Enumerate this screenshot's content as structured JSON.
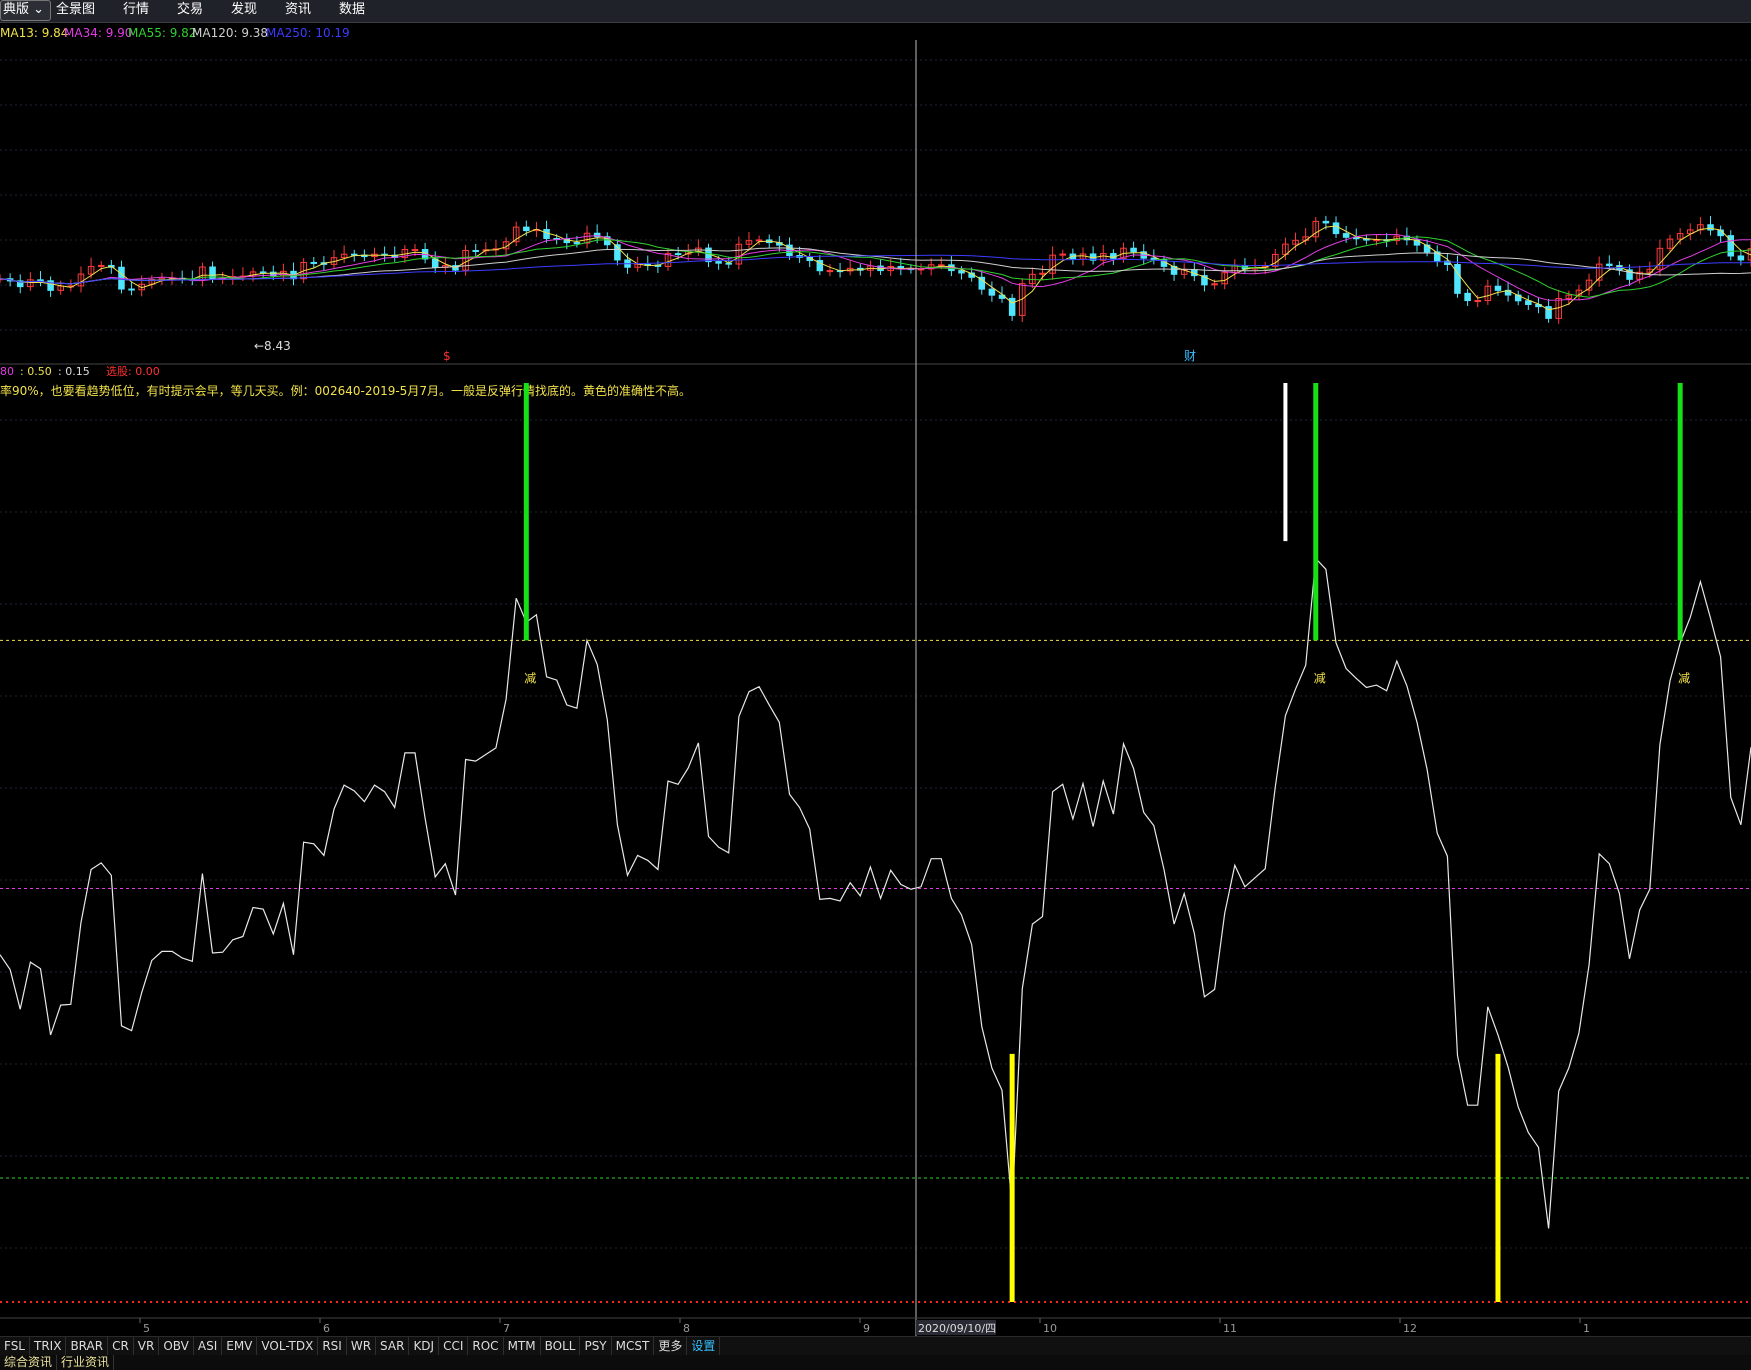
{
  "menubar": {
    "edition_label": "典版",
    "edition_icon": "chevron-down-icon",
    "items": [
      "全景图",
      "行情",
      "交易",
      "发现",
      "资讯",
      "数据"
    ]
  },
  "price_panel": {
    "ma_legend": [
      {
        "label": "MA13",
        "value": "9.84",
        "color": "#f2e24a"
      },
      {
        "label": "MA34",
        "value": "9.90",
        "color": "#e23de3"
      },
      {
        "label": "MA55",
        "value": "9.82",
        "color": "#30d030"
      },
      {
        "label": "MA120",
        "value": "9.38",
        "color": "#cfcfcf"
      },
      {
        "label": "MA250",
        "value": "10.19",
        "color": "#3c3cff"
      }
    ],
    "low_price_label": "←8.43",
    "markers": {
      "dividend": "$",
      "finance": "财"
    },
    "colors": {
      "up": "#ff3a3a",
      "down": "#50e6ff"
    }
  },
  "indicator_panel": {
    "params": {
      "p1": "80",
      "p2": "0.50",
      "p3": "0.15",
      "select_label": "选股",
      "select_value": "0.00"
    },
    "description": "率90%，也要看趋势低位，有时提示会早，等几天买。例：002640-2019-5月7月。一般是反弹行情找底的。黄色的准确性不高。",
    "sell_label": "减",
    "colors": {
      "line": "#e8e8e8",
      "sell_bar": "#16e016",
      "buy_bar": "#ffff00",
      "alert_bar": "#ffffff"
    }
  },
  "time_axis": {
    "month_ticks": [
      "5",
      "6",
      "7",
      "8",
      "9",
      "10",
      "11",
      "12",
      "1"
    ],
    "cursor_date": "2020/09/10/四"
  },
  "chart_data": {
    "type": "line",
    "indicator_y_range": [
      0,
      100
    ],
    "indicator_levels": [
      80,
      50,
      15,
      0
    ],
    "indicator_values": [
      42.0,
      40.2,
      35.4,
      41.1,
      40.3,
      32.3,
      35.9,
      36.0,
      45.9,
      52.3,
      53.1,
      51.6,
      33.4,
      32.8,
      37.4,
      41.3,
      42.4,
      42.4,
      41.6,
      41.2,
      51.8,
      42.2,
      42.3,
      43.8,
      44.2,
      47.7,
      47.5,
      44.5,
      48.2,
      42.0,
      55.6,
      55.4,
      54.0,
      59.6,
      62.5,
      61.8,
      60.5,
      62.5,
      61.7,
      59.8,
      66.4,
      66.4,
      58.5,
      51.4,
      53.0,
      49.2,
      65.6,
      65.4,
      66.2,
      67.0,
      72.9,
      85.1,
      82.2,
      83.1,
      75.6,
      75.2,
      72.2,
      71.8,
      80.0,
      77.1,
      70.4,
      57.7,
      51.6,
      54.0,
      53.4,
      52.3,
      63.0,
      62.6,
      64.6,
      67.6,
      56.3,
      55.0,
      54.3,
      70.8,
      73.8,
      74.4,
      72.2,
      70.1,
      61.4,
      59.8,
      57.2,
      48.7,
      48.8,
      48.5,
      50.7,
      49.1,
      52.6,
      48.8,
      52.2,
      50.5,
      49.9,
      50.2,
      53.6,
      53.6,
      48.8,
      46.8,
      43.2,
      33.3,
      28.3,
      25.6,
      11.4,
      37.9,
      45.7,
      46.6,
      61.7,
      62.6,
      58.4,
      62.7,
      57.5,
      63.0,
      59.0,
      67.5,
      64.5,
      59.2,
      57.6,
      52.3,
      45.7,
      49.4,
      44.6,
      36.9,
      37.8,
      47.0,
      52.8,
      50.2,
      51.3,
      52.4,
      62.3,
      70.9,
      74.1,
      77.0,
      89.9,
      88.6,
      79.7,
      76.6,
      75.4,
      74.3,
      74.6,
      73.9,
      77.5,
      74.5,
      70.1,
      64.4,
      56.7,
      53.9,
      29.8,
      23.8,
      23.8,
      35.7,
      32.3,
      28.4,
      23.6,
      20.5,
      18.7,
      8.9,
      25.5,
      28.3,
      32.5,
      40.8,
      54.2,
      53.0,
      49.4,
      41.5,
      47.4,
      49.9,
      67.4,
      75.1,
      79.7,
      82.8,
      87.1,
      82.7,
      78.0,
      61.0,
      57.7,
      67.1
    ],
    "sell_signal_indices": [
      52,
      130,
      166
    ],
    "buy_signal_indices": [
      100,
      148
    ],
    "alert_signal_indices": [
      127
    ],
    "price_high": 11.44,
    "price_low": 8.43
  }
}
